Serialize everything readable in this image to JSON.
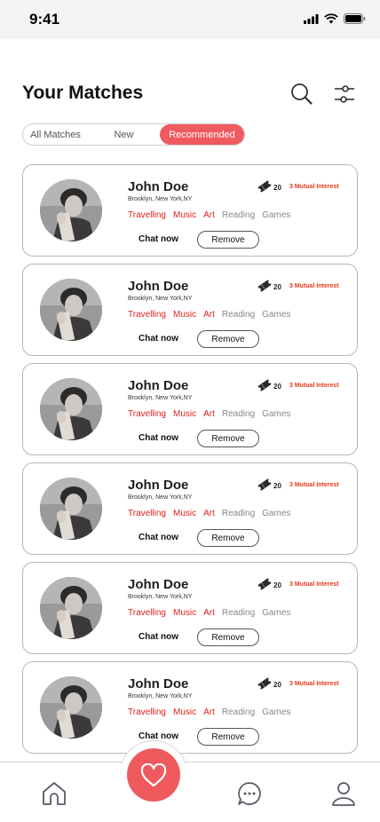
{
  "status_bar": {
    "time": "9:41"
  },
  "header": {
    "title": "Your Matches"
  },
  "filter_tabs": [
    {
      "label": "All Matches",
      "active": false
    },
    {
      "label": "New",
      "active": false
    },
    {
      "label": "Recommended",
      "active": true
    }
  ],
  "matches": [
    {
      "name": "John Doe",
      "location": "Brooklyn, New York,NY",
      "interest_count": "20",
      "mutual_label": "3 Mutual Interest",
      "tags": [
        {
          "label": "Travelling",
          "mutual": true
        },
        {
          "label": "Music",
          "mutual": true
        },
        {
          "label": "Art",
          "mutual": true
        },
        {
          "label": "Reading",
          "mutual": false
        },
        {
          "label": "Games",
          "mutual": false
        }
      ],
      "chat_label": "Chat now",
      "remove_label": "Remove"
    },
    {
      "name": "John Doe",
      "location": "Brooklyn, New York,NY",
      "interest_count": "20",
      "mutual_label": "3 Mutual Interest",
      "tags": [
        {
          "label": "Travelling",
          "mutual": true
        },
        {
          "label": "Music",
          "mutual": true
        },
        {
          "label": "Art",
          "mutual": true
        },
        {
          "label": "Reading",
          "mutual": false
        },
        {
          "label": "Games",
          "mutual": false
        }
      ],
      "chat_label": "Chat now",
      "remove_label": "Remove"
    },
    {
      "name": "John Doe",
      "location": "Brooklyn, New York,NY",
      "interest_count": "20",
      "mutual_label": "3 Mutual Interest",
      "tags": [
        {
          "label": "Travelling",
          "mutual": true
        },
        {
          "label": "Music",
          "mutual": true
        },
        {
          "label": "Art",
          "mutual": true
        },
        {
          "label": "Reading",
          "mutual": false
        },
        {
          "label": "Games",
          "mutual": false
        }
      ],
      "chat_label": "Chat now",
      "remove_label": "Remove"
    },
    {
      "name": "John Doe",
      "location": "Brooklyn, New York,NY",
      "interest_count": "20",
      "mutual_label": "3 Mutual Interest",
      "tags": [
        {
          "label": "Travelling",
          "mutual": true
        },
        {
          "label": "Music",
          "mutual": true
        },
        {
          "label": "Art",
          "mutual": true
        },
        {
          "label": "Reading",
          "mutual": false
        },
        {
          "label": "Games",
          "mutual": false
        }
      ],
      "chat_label": "Chat now",
      "remove_label": "Remove"
    },
    {
      "name": "John Doe",
      "location": "Brooklyn, New York,NY",
      "interest_count": "20",
      "mutual_label": "3 Mutual Interest",
      "tags": [
        {
          "label": "Travelling",
          "mutual": true
        },
        {
          "label": "Music",
          "mutual": true
        },
        {
          "label": "Art",
          "mutual": true
        },
        {
          "label": "Reading",
          "mutual": false
        },
        {
          "label": "Games",
          "mutual": false
        }
      ],
      "chat_label": "Chat now",
      "remove_label": "Remove"
    },
    {
      "name": "John Doe",
      "location": "Brooklyn, New York,NY",
      "interest_count": "20",
      "mutual_label": "3 Mutual Interest",
      "tags": [
        {
          "label": "Travelling",
          "mutual": true
        },
        {
          "label": "Music",
          "mutual": true
        },
        {
          "label": "Art",
          "mutual": true
        },
        {
          "label": "Reading",
          "mutual": false
        },
        {
          "label": "Games",
          "mutual": false
        }
      ],
      "chat_label": "Chat now",
      "remove_label": "Remove"
    }
  ],
  "icons": {
    "header": [
      "search-icon",
      "filter-sliders-icon"
    ],
    "nav": [
      "home-icon",
      "heart-icon",
      "chat-icon",
      "profile-icon"
    ],
    "card": [
      "ticket-icon"
    ]
  },
  "colors": {
    "accent": "#ef5a5f",
    "mutual_tag": "#e02020",
    "mutual_label": "#e33a1e",
    "muted_tag": "#888888"
  }
}
